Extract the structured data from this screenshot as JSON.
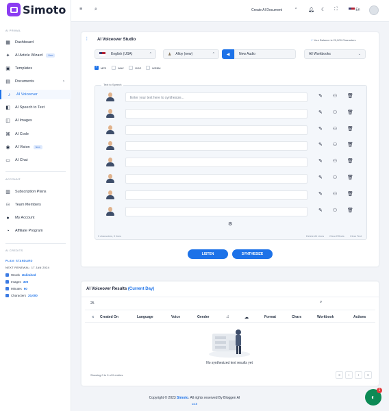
{
  "brand": {
    "name": "Simoto",
    "accent": "#1d72e8",
    "logo_color": "#8b3cf2"
  },
  "sidebar": {
    "section_aiprimal": "AI PRIMAL",
    "items": [
      {
        "label": "Dashboard",
        "icon": "dashboard-icon"
      },
      {
        "label": "AI Article Wizard",
        "icon": "wizard-icon",
        "badge": "New"
      },
      {
        "label": "Templates",
        "icon": "templates-icon"
      },
      {
        "label": "Documents",
        "icon": "documents-icon"
      },
      {
        "label": "AI Voiceover",
        "icon": "voiceover-icon"
      },
      {
        "label": "AI Speech to Text",
        "icon": "speech-icon"
      },
      {
        "label": "AI Images",
        "icon": "images-icon"
      },
      {
        "label": "AI Code",
        "icon": "code-icon"
      },
      {
        "label": "AI Vision",
        "icon": "vision-icon",
        "badge": "New"
      },
      {
        "label": "AI Chat",
        "icon": "chat-icon"
      }
    ],
    "section_account": "ACCOUNT",
    "account_items": [
      {
        "label": "Subscription Plans",
        "icon": "plans-icon"
      },
      {
        "label": "Team Members",
        "icon": "team-icon"
      },
      {
        "label": "My Account",
        "icon": "account-icon"
      },
      {
        "label": "Affiliate Program",
        "icon": "affiliate-icon"
      }
    ],
    "section_credits": "AI CREDITS",
    "plan": "PLAN: STANDARD",
    "renewal": "NEXT RENEWAL: 17 JAN 2024",
    "credits": [
      {
        "label": "Words",
        "value": "Unlimited"
      },
      {
        "label": "Images",
        "value": "300"
      },
      {
        "label": "Minutes",
        "value": "60"
      },
      {
        "label": "Characters",
        "value": "20,000"
      }
    ]
  },
  "topbar": {
    "create_doc": "Create AI Document",
    "lang": "En"
  },
  "studio": {
    "title": "AI Voiceover Studio",
    "balance": "Your Balance is 20,000 Characters",
    "language": "English (USA)",
    "voice": "Alloy (new)",
    "audio_name": "New Audio",
    "workbook": "All Workbooks",
    "formats": [
      "MP3",
      "WAV",
      "OGG",
      "WEBM"
    ],
    "tts_label": "Text to Speech",
    "placeholder": "Enter your text here to synthesize...",
    "char_count": "0 characters, 0 lines",
    "delete_lines": "Delete All Lines",
    "clear_effects": "Clear Effects",
    "clear_text": "Clear Text",
    "listen": "LISTEN",
    "synthesize": "SYNTHESIZE"
  },
  "results": {
    "title": "AI Voiceover Results",
    "period": "(Current Day)",
    "page_size": "25",
    "columns": [
      "Created On",
      "Language",
      "Voice",
      "Gender",
      "Format",
      "Chars",
      "Workbook",
      "Actions"
    ],
    "empty": "No synthesized text results yet",
    "showing": "Showing 0 to 0 of 0 entries",
    "pager": [
      "«",
      "‹",
      "›",
      "»"
    ]
  },
  "footer": {
    "prefix": "Copyright © 2023 ",
    "brand": "Simoto",
    "suffix": ". All rights reserved By Bloggen AI",
    "version": "v2.5"
  },
  "chat_badge": "1"
}
